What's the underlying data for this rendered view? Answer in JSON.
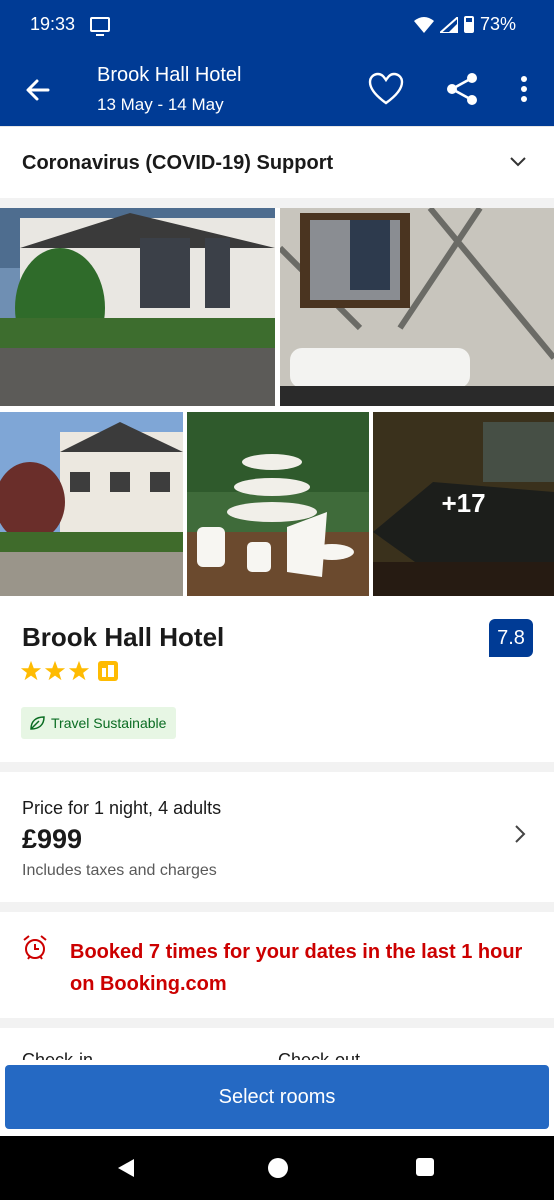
{
  "status_bar": {
    "time": "19:33",
    "battery": "73%"
  },
  "app_bar": {
    "title": "Brook Hall Hotel",
    "dates": "13 May - 14 May"
  },
  "covid": {
    "title": "Coronavirus (COVID-19) Support"
  },
  "gallery": {
    "more_count": "+17"
  },
  "hotel": {
    "name": "Brook Hall Hotel",
    "score": "7.8",
    "stars": 3,
    "sustainable_label": "Travel Sustainable"
  },
  "price": {
    "label": "Price for 1 night, 4 adults",
    "value": "£999",
    "note": "Includes taxes and charges"
  },
  "booked": {
    "text": "Booked 7 times for your dates in the last 1 hour on Booking.com"
  },
  "checkin": {
    "check_in_label": "Check-in",
    "check_out_label": "Check-out"
  },
  "cta": {
    "label": "Select rooms"
  },
  "colors": {
    "brand": "#003b95",
    "cta": "#2569c3",
    "star": "#febb02",
    "alert": "#cc0000"
  }
}
